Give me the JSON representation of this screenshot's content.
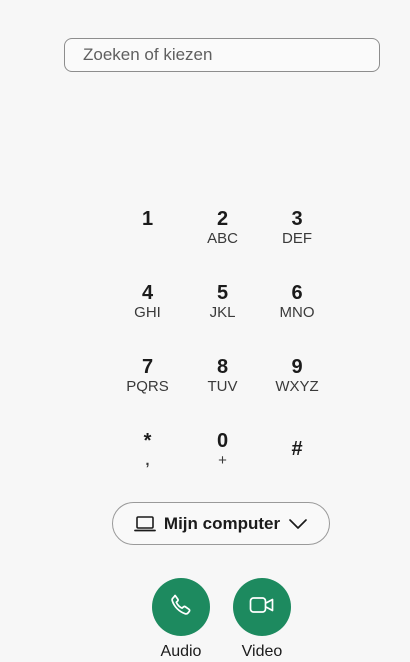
{
  "search": {
    "placeholder": "Zoeken of kiezen",
    "value": ""
  },
  "keypad": {
    "keys": [
      {
        "digit": "1",
        "letters": ""
      },
      {
        "digit": "2",
        "letters": "ABC"
      },
      {
        "digit": "3",
        "letters": "DEF"
      },
      {
        "digit": "4",
        "letters": "GHI"
      },
      {
        "digit": "5",
        "letters": "JKL"
      },
      {
        "digit": "6",
        "letters": "MNO"
      },
      {
        "digit": "7",
        "letters": "PQRS"
      },
      {
        "digit": "8",
        "letters": "TUV"
      },
      {
        "digit": "9",
        "letters": "WXYZ"
      },
      {
        "digit": "*",
        "letters": ","
      },
      {
        "digit": "0",
        "letters": "+"
      },
      {
        "digit": "#",
        "letters": ""
      }
    ]
  },
  "device_selector": {
    "label": "Mijn computer",
    "icon": "laptop-icon",
    "chevron_icon": "chevron-down-icon"
  },
  "calls": {
    "audio": {
      "label": "Audio",
      "icon": "phone-icon"
    },
    "video": {
      "label": "Video",
      "icon": "video-camera-icon"
    }
  },
  "colors": {
    "accent": "#1d8a5f",
    "background": "#f7f7f7"
  }
}
